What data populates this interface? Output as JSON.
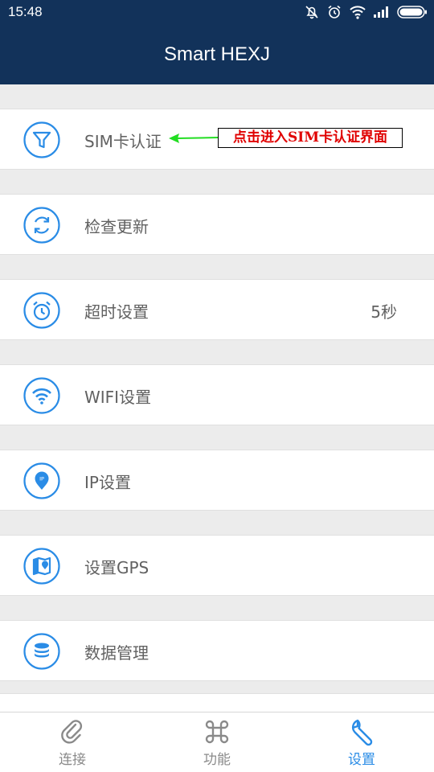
{
  "status_bar": {
    "time": "15:48",
    "icons": [
      "notifications-off-icon",
      "alarm-icon",
      "wifi-icon",
      "signal-icon",
      "battery-icon"
    ]
  },
  "app_bar": {
    "title": "Smart HEXJ"
  },
  "settings": [
    {
      "label": "SIM卡认证",
      "icon": "funnel-icon",
      "value": ""
    },
    {
      "label": "检查更新",
      "icon": "refresh-icon",
      "value": ""
    },
    {
      "label": "超时设置",
      "icon": "alarm-clock-icon",
      "value": "5秒"
    },
    {
      "label": "WIFI设置",
      "icon": "wifi-icon",
      "value": ""
    },
    {
      "label": "IP设置",
      "icon": "ip-location-icon",
      "value": ""
    },
    {
      "label": "设置GPS",
      "icon": "map-icon",
      "value": ""
    },
    {
      "label": "数据管理",
      "icon": "database-icon",
      "value": ""
    }
  ],
  "annotation": {
    "text": "点击进入SIM卡认证界面"
  },
  "bottom_nav": {
    "tabs": [
      {
        "label": "连接",
        "icon": "paperclip-icon",
        "active": false
      },
      {
        "label": "功能",
        "icon": "command-icon",
        "active": false
      },
      {
        "label": "设置",
        "icon": "wrench-icon",
        "active": true
      }
    ]
  },
  "colors": {
    "header": "#12325a",
    "accent": "#2a8ce6",
    "annotation_text": "#e00000",
    "annotation_arrow": "#22dd22",
    "label_text": "#616161",
    "nav_inactive": "#8a8a8a"
  }
}
